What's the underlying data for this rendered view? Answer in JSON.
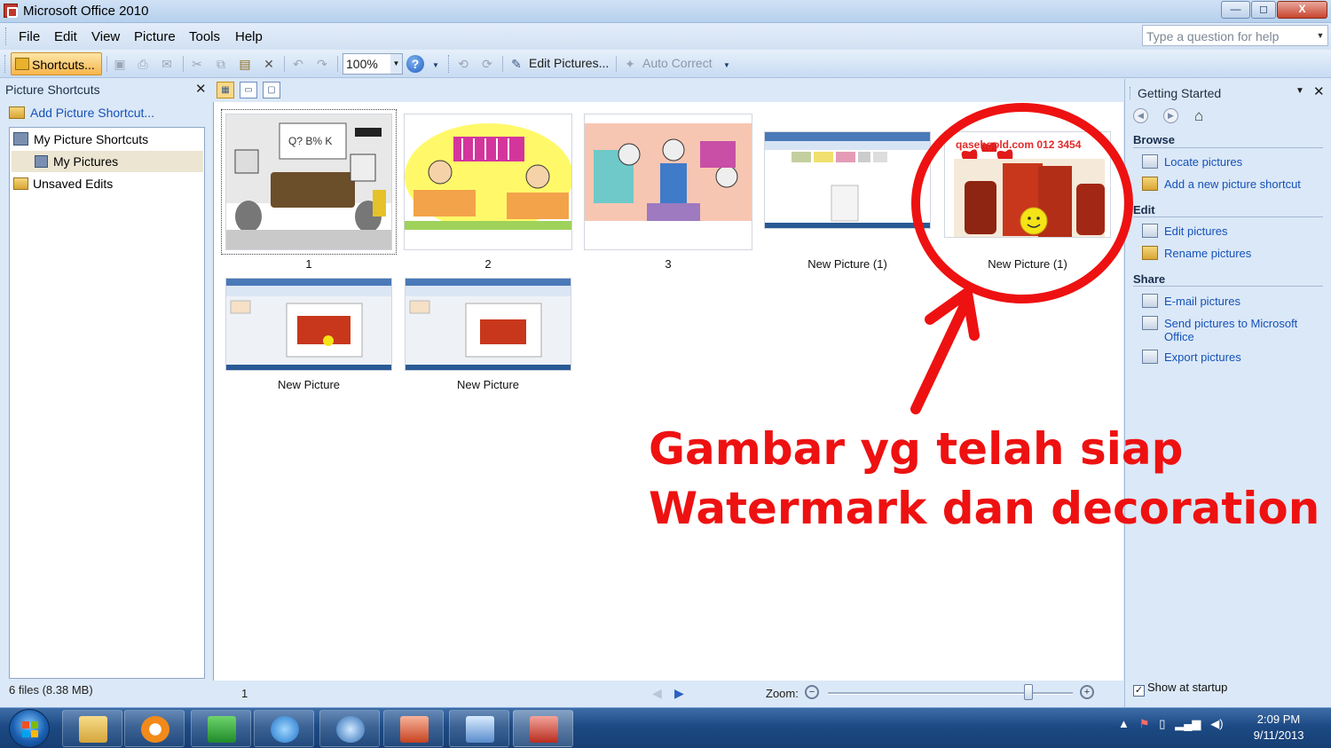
{
  "window": {
    "title": "Microsoft Office 2010",
    "minimize": "—",
    "maximize": "◻",
    "close": "X"
  },
  "menu": [
    "File",
    "Edit",
    "View",
    "Picture",
    "Tools",
    "Help"
  ],
  "help_search": {
    "placeholder": "Type a question for help"
  },
  "toolbar": {
    "shortcuts_label": "Shortcuts...",
    "zoom_value": "100%",
    "edit_pictures_label": "Edit Pictures...",
    "auto_correct_label": "Auto Correct"
  },
  "left_pane": {
    "title": "Picture Shortcuts",
    "add_shortcut": "Add Picture Shortcut...",
    "tree": [
      "My Picture Shortcuts",
      "My Pictures",
      "Unsaved Edits"
    ],
    "file_count": "6 files (8.38 MB)"
  },
  "thumbnails": [
    {
      "label": "1"
    },
    {
      "label": "2"
    },
    {
      "label": "3"
    },
    {
      "label": "New Picture (1)"
    },
    {
      "label": "New Picture (1)",
      "watermark_text": "qasehgold.com  012 3454"
    },
    {
      "label": "New Picture"
    },
    {
      "label": "New Picture"
    }
  ],
  "status": {
    "page": "1",
    "zoom_label": "Zoom:",
    "zoom_level": 0.82
  },
  "right_pane": {
    "title": "Getting Started",
    "sections": [
      {
        "heading": "Browse",
        "links": [
          "Locate pictures",
          "Add a new picture shortcut"
        ]
      },
      {
        "heading": "Edit",
        "links": [
          "Edit pictures",
          "Rename pictures"
        ]
      },
      {
        "heading": "Share",
        "links": [
          "E-mail pictures",
          "Send pictures to Microsoft Office",
          "Export pictures"
        ]
      }
    ],
    "show_at_startup": "Show at startup"
  },
  "taskbar": {
    "time": "2:09 PM",
    "date": "9/11/2013"
  },
  "annotation": {
    "line1": "Gambar yg telah siap",
    "line2": "Watermark dan decoration",
    "color": "#ee1111"
  }
}
